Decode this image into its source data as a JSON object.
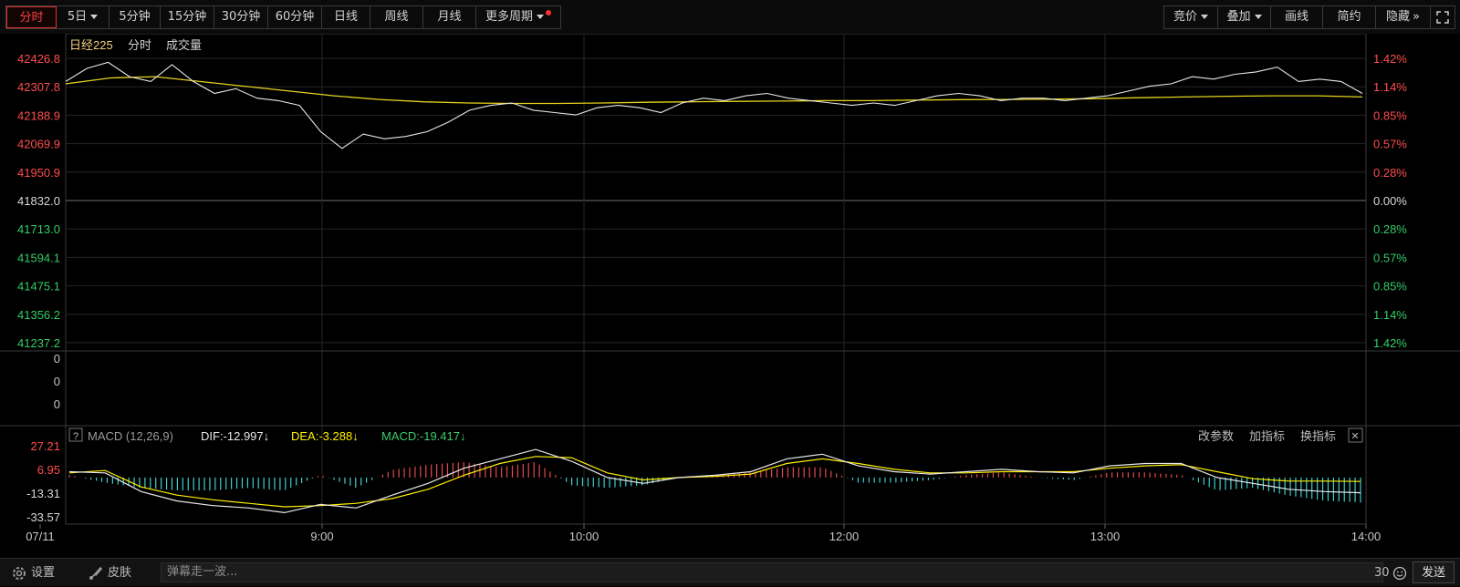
{
  "toolbar": {
    "tabs": [
      {
        "label": "分时",
        "active": true
      },
      {
        "label": "5日",
        "dropdown": true
      },
      {
        "label": "5分钟"
      },
      {
        "label": "15分钟"
      },
      {
        "label": "30分钟"
      },
      {
        "label": "60分钟"
      },
      {
        "label": "日线"
      },
      {
        "label": "周线"
      },
      {
        "label": "月线"
      },
      {
        "label": "更多周期",
        "dropdown": true,
        "badge": true
      }
    ],
    "right_buttons": [
      {
        "label": "竞价",
        "dropdown": true
      },
      {
        "label": "叠加",
        "dropdown": true
      },
      {
        "label": "画线"
      },
      {
        "label": "简约"
      },
      {
        "label": "隐藏",
        "arrow": "»"
      }
    ],
    "fullscreen_icon": "expand-icon"
  },
  "chart_header": {
    "name": "日经225",
    "mode": "分时",
    "volume_label": "成交量"
  },
  "price_axis": {
    "left": [
      "42426.8",
      "42307.8",
      "42188.9",
      "42069.9",
      "41950.9",
      "41832.0",
      "41713.0",
      "41594.1",
      "41475.1",
      "41356.2",
      "41237.2"
    ],
    "right": [
      "1.42%",
      "1.14%",
      "0.85%",
      "0.57%",
      "0.28%",
      "0.00%",
      "0.28%",
      "0.57%",
      "0.85%",
      "1.14%",
      "1.42%"
    ]
  },
  "volume_axis": [
    "0",
    "0",
    "0"
  ],
  "macd_header": {
    "help": "?",
    "name": "MACD (12,26,9)",
    "dif": "DIF:-12.997↓",
    "dea": "DEA:-3.288↓",
    "macd": "MACD:-19.417↓",
    "actions": [
      "改参数",
      "加指标",
      "换指标"
    ],
    "close": "✕"
  },
  "macd_axis": [
    "27.21",
    "6.95",
    "-13.31",
    "-33.57"
  ],
  "time_axis": [
    "07/11",
    "9:00",
    "10:00",
    "12:00",
    "13:00",
    "14:00"
  ],
  "colors": {
    "up": "#ff4d4d",
    "down": "#33cc66",
    "price_line": "#e8e8e8",
    "avg_line": "#e6d21e",
    "dea_color": "#ffee00",
    "macd_label_color": "#3dcc6a",
    "hist_up": "#e24b4b",
    "hist_down": "#3ecfd0",
    "grid": "#3a3a3a"
  },
  "chart_data": [
    {
      "type": "line",
      "title": "日经225 分时",
      "x": [
        "07/11",
        "9:00",
        "10:00",
        "12:00",
        "13:00",
        "14:00"
      ],
      "ylim": [
        41237.2,
        42426.8
      ],
      "prev_close": 41832.0,
      "series": [
        {
          "name": "price",
          "values": [
            42330,
            42385,
            42410,
            42350,
            42330,
            42400,
            42330,
            42280,
            42300,
            42260,
            42250,
            42230,
            42120,
            42050,
            42110,
            42090,
            42100,
            42120,
            42160,
            42210,
            42230,
            42240,
            42210,
            42200,
            42190,
            42220,
            42230,
            42220,
            42200,
            42240,
            42260,
            42250,
            42270,
            42280,
            42260,
            42250,
            42240,
            42230,
            42240,
            42230,
            42250,
            42270,
            42280,
            42270,
            42250,
            42260,
            42260,
            42250,
            42260,
            42270,
            42290,
            42310,
            42320,
            42350,
            42340,
            42360,
            42370,
            42390,
            42330,
            42340,
            42330,
            42280
          ]
        },
        {
          "name": "avg",
          "values": [
            42320,
            42345,
            42350,
            42330,
            42310,
            42290,
            42270,
            42255,
            42245,
            42240,
            42238,
            42238,
            42240,
            42243,
            42245,
            42247,
            42248,
            42250,
            42250,
            42252,
            42254,
            42255,
            42256,
            42258,
            42262,
            42265,
            42268,
            42270,
            42270,
            42265
          ]
        }
      ]
    },
    {
      "type": "line",
      "title": "MACD (12,26,9)",
      "ylim": [
        -33.57,
        27.21
      ],
      "series": [
        {
          "name": "DIF",
          "values": [
            5,
            4,
            -12,
            -20,
            -24,
            -26,
            -30,
            -23,
            -26,
            -15,
            -5,
            8,
            16,
            24,
            14,
            0,
            -5,
            0,
            2,
            5,
            16,
            20,
            10,
            5,
            3,
            5,
            7,
            5,
            4,
            10,
            12,
            12,
            0,
            -5,
            -10,
            -12,
            -13
          ]
        },
        {
          "name": "DEA",
          "values": [
            4,
            6,
            -8,
            -15,
            -19,
            -22,
            -25,
            -24,
            -22,
            -18,
            -10,
            2,
            12,
            18,
            17,
            4,
            -2,
            0,
            1,
            3,
            12,
            16,
            12,
            7,
            4,
            4,
            5,
            5,
            5,
            8,
            10,
            11,
            5,
            -1,
            -3,
            -3,
            -3.3
          ]
        }
      ]
    }
  ],
  "bottom_bar": {
    "settings": "设置",
    "skin": "皮肤",
    "danmu_placeholder": "弹幕走一波...",
    "counter": "30",
    "send": "发送"
  }
}
